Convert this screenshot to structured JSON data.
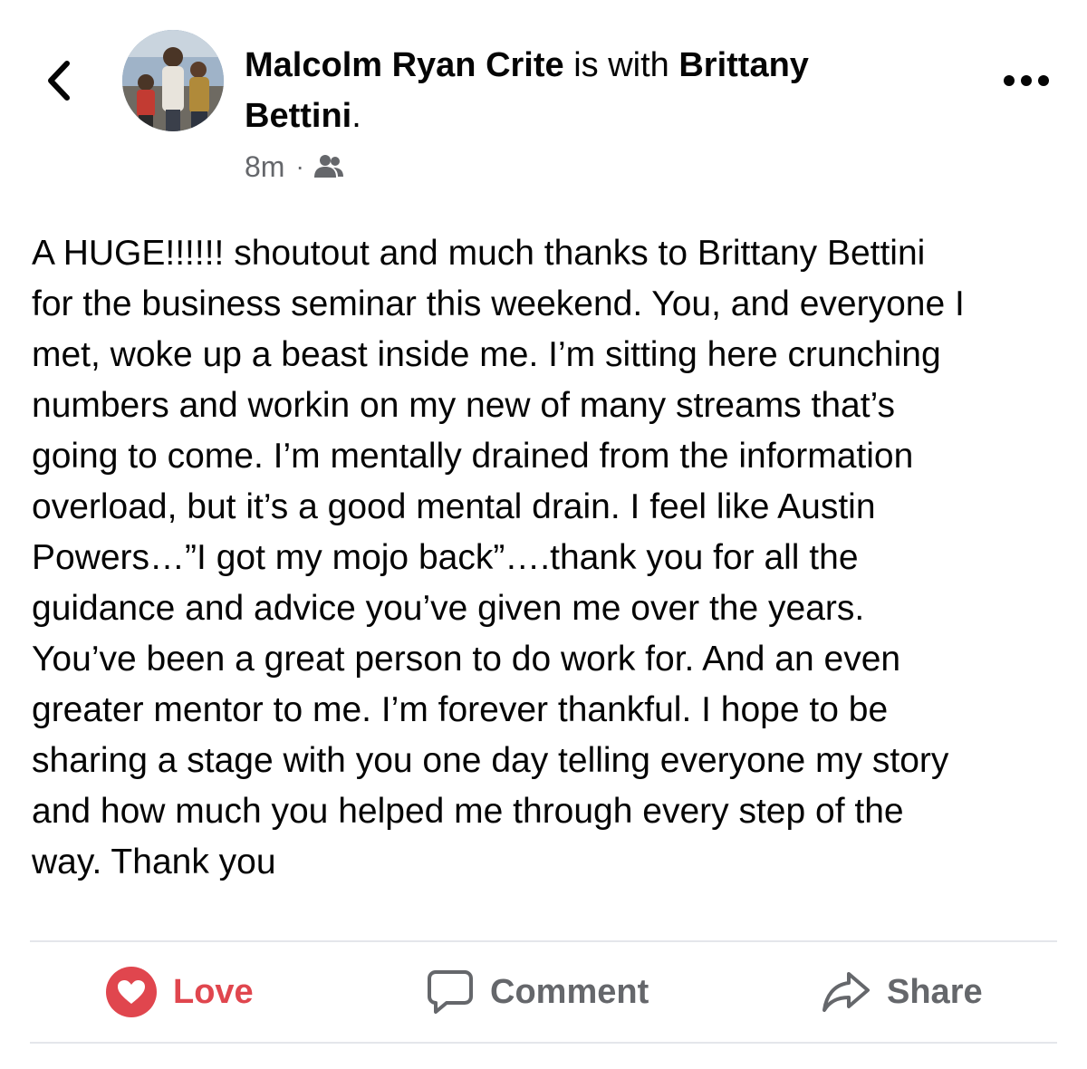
{
  "header": {
    "author_name": "Malcolm Ryan Crite",
    "connector": "is with",
    "tagged_name": "Brittany Bettini",
    "tagged_suffix": ".",
    "timestamp": "8m",
    "separator": "·",
    "audience_icon": "friends-icon"
  },
  "post": {
    "lines": [
      "A HUGE!!!!!! shoutout and much thanks to Brittany Bettini",
      "for the business seminar this weekend. You, and everyone I",
      "met, woke up a beast inside me. I’m sitting here crunching",
      "numbers and workin on my new of many streams that’s",
      "going to come. I’m mentally drained from the information",
      "overload, but it’s a good mental drain. I feel like Austin",
      "Powers…”I got my mojo back”….thank you for all the",
      "guidance and advice you’ve given me over the years.",
      "You’ve been a great person to do work for. And an even",
      "greater mentor to me. I’m forever thankful. I hope to be",
      "sharing a stage with you one day telling everyone my story",
      "and how much you helped me through every step of the",
      "way. Thank you"
    ]
  },
  "actions": {
    "love_label": "Love",
    "comment_label": "Comment",
    "share_label": "Share"
  },
  "colors": {
    "love": "#e0464e",
    "secondary_text": "#65676b",
    "divider": "#e4e6eb"
  },
  "icons": {
    "back": "chevron-left-icon",
    "more": "more-horizontal-icon",
    "love": "heart-icon",
    "comment": "comment-bubble-icon",
    "share": "share-arrow-icon"
  }
}
